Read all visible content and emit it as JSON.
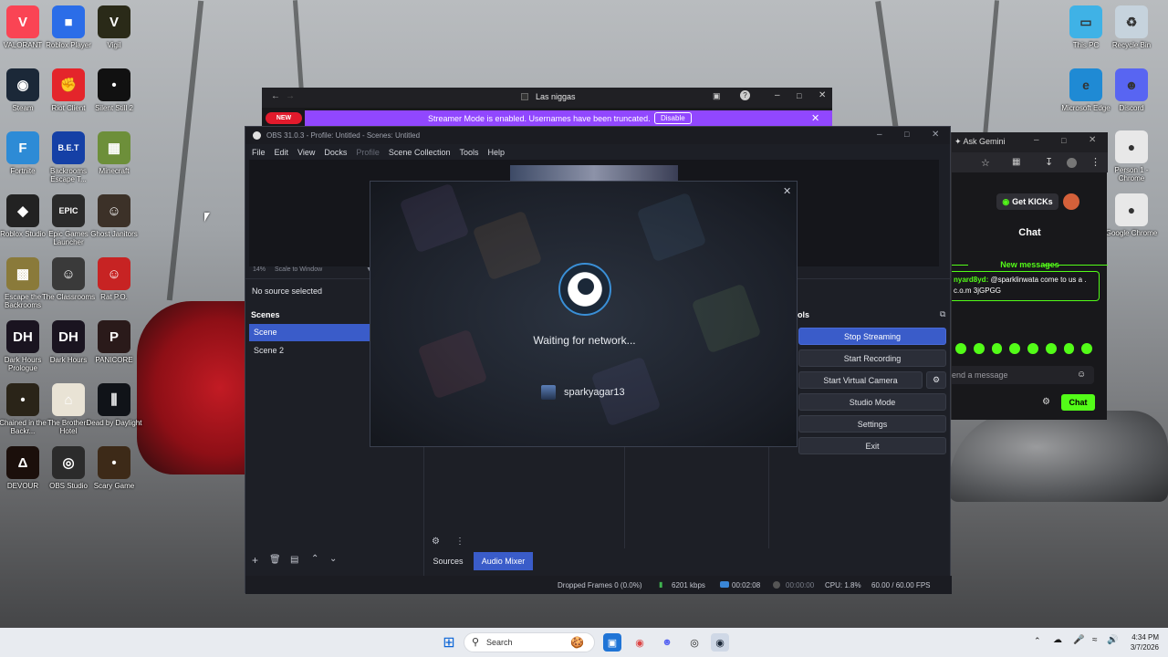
{
  "desktop": {
    "icons": [
      {
        "label": "VALORANT",
        "glyph": "V",
        "color": "#fa4454"
      },
      {
        "label": "Roblox Player",
        "glyph": "■",
        "color": "#2b6de8"
      },
      {
        "label": "Vigil",
        "glyph": "V",
        "color": "#2a2a18"
      },
      {
        "label": "Steam",
        "glyph": "◉",
        "color": "#1b2838"
      },
      {
        "label": "Riot Client",
        "glyph": "✊",
        "color": "#e4252b"
      },
      {
        "label": "Silent Still 2",
        "glyph": "•",
        "color": "#111111"
      },
      {
        "label": "Fortnite",
        "glyph": "F",
        "color": "#2d8bd6"
      },
      {
        "label": "Backrooms Escape T...",
        "glyph": "B.E.T",
        "color": "#1540a6"
      },
      {
        "label": "Minecraft",
        "glyph": "▦",
        "color": "#6d8f3a"
      },
      {
        "label": "Roblox Studio",
        "glyph": "◆",
        "color": "#222222"
      },
      {
        "label": "Epic Games Launcher",
        "glyph": "EPIC",
        "color": "#2a2a2a"
      },
      {
        "label": "Ghost Janitors",
        "glyph": "☺",
        "color": "#3c3128"
      },
      {
        "label": "Escape the Backrooms",
        "glyph": "▩",
        "color": "#8a7a3a"
      },
      {
        "label": "The Classrooms",
        "glyph": "☺",
        "color": "#3a3a3a"
      },
      {
        "label": "Rat P.O.",
        "glyph": "☺",
        "color": "#c72323"
      },
      {
        "label": "Dark Hours Prologue",
        "glyph": "DH",
        "color": "#1a1420"
      },
      {
        "label": "Dark Hours",
        "glyph": "DH",
        "color": "#1a1420"
      },
      {
        "label": "PANICORE",
        "glyph": "P",
        "color": "#2a1a1a"
      },
      {
        "label": "Chained in the Backr...",
        "glyph": "•",
        "color": "#2a2418"
      },
      {
        "label": "The Brothers Hotel",
        "glyph": "⌂",
        "color": "#e9e3d5"
      },
      {
        "label": "Dead by Daylight",
        "glyph": "⫼",
        "color": "#101318"
      },
      {
        "label": "DEVOUR",
        "glyph": "Δ",
        "color": "#1b0f0b"
      },
      {
        "label": "OBS Studio",
        "glyph": "◎",
        "color": "#2b2b2b"
      },
      {
        "label": "Scary Game",
        "glyph": "•",
        "color": "#3d2a18"
      }
    ],
    "right_icons": [
      {
        "label": "This PC",
        "glyph": "▭",
        "color": "#3fb2e6"
      },
      {
        "label": "Recycle Bin",
        "glyph": "♻",
        "color": "#c6d3dd"
      },
      {
        "label": "Microsoft Edge",
        "glyph": "e",
        "color": "#1f8ad4"
      },
      {
        "label": "Discord",
        "glyph": "☻",
        "color": "#5865f2"
      },
      {
        "label": "Person 1 - Chrome",
        "glyph": "●",
        "color": "#e8e8e8"
      },
      {
        "label": "Google Chrome",
        "glyph": "●",
        "color": "#e8e8e8"
      }
    ]
  },
  "browser": {
    "tab_title": "Las niggas",
    "new_badge": "NEW",
    "banner_text": "Streamer Mode is enabled. Usernames have been truncated.",
    "disable_label": "Disable",
    "accent": "#9147ff"
  },
  "obs": {
    "title": "OBS 31.0.3 - Profile: Untitled - Scenes: Untitled",
    "menu": [
      "File",
      "Edit",
      "View",
      "Docks",
      "Profile",
      "Scene Collection",
      "Tools",
      "Help"
    ],
    "zoom": "14%",
    "scale_mode": "Scale to Window",
    "no_source": "No source selected",
    "scenes_header": "Scenes",
    "scenes": [
      "Scene",
      "Scene 2"
    ],
    "tabs": {
      "sources": "Sources",
      "audio_mixer": "Audio Mixer"
    },
    "controls_header": "ols",
    "controls": {
      "stop_streaming": "Stop Streaming",
      "start_recording": "Start Recording",
      "start_virtual_camera": "Start Virtual Camera",
      "studio_mode": "Studio Mode",
      "settings": "Settings",
      "exit": "Exit"
    },
    "status": {
      "dropped_frames": "Dropped Frames 0 (0.0%)",
      "bitrate": "6201 kbps",
      "stream_time": "00:02:08",
      "record_time": "00:00:00",
      "cpu": "CPU: 1.8%",
      "fps": "60.00 / 60.00 FPS"
    },
    "accent": "#3a5cc9"
  },
  "steam_dialog": {
    "message": "Waiting for network...",
    "username": "sparkyagar13"
  },
  "side_window": {
    "tab_title": "Ask Gemini",
    "get_kicks": "Get KICKs",
    "chat_title": "Chat",
    "new_messages": "New messages",
    "message_user": "nyard8yd:",
    "message_text": "@sparklinwata come to us a . c.o.m 3jGPGG",
    "input_placeholder": "end a message",
    "chat_button": "Chat",
    "accent": "#53fc18"
  },
  "taskbar": {
    "search_label": "Search",
    "time": "4:34 PM",
    "date": "3/7/2026"
  }
}
